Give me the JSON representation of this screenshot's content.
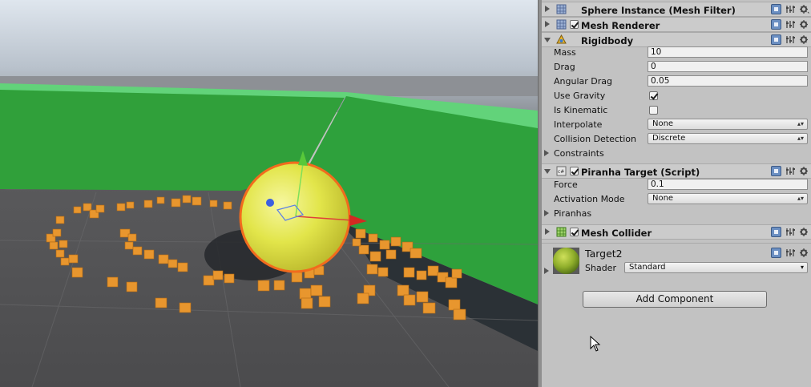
{
  "inspector": {
    "components": [
      {
        "title": "Sphere Instance (Mesh Filter)",
        "icon": "mesh-filter-icon",
        "has_checkbox": false,
        "expanded": false
      },
      {
        "title": "Mesh Renderer",
        "icon": "mesh-renderer-icon",
        "has_checkbox": true,
        "checked": true,
        "expanded": false
      },
      {
        "title": "Rigidbody",
        "icon": "rigidbody-icon",
        "has_checkbox": false,
        "expanded": true
      },
      {
        "title": "Piranha Target (Script)",
        "icon": "script-icon",
        "has_checkbox": true,
        "checked": true,
        "expanded": true
      },
      {
        "title": "Mesh Collider",
        "icon": "mesh-collider-icon",
        "has_checkbox": true,
        "checked": true,
        "expanded": false
      }
    ],
    "rigidbody": {
      "mass_label": "Mass",
      "mass": "10",
      "drag_label": "Drag",
      "drag": "0",
      "angular_drag_label": "Angular Drag",
      "angular_drag": "0.05",
      "use_gravity_label": "Use Gravity",
      "use_gravity": true,
      "is_kinematic_label": "Is Kinematic",
      "is_kinematic": false,
      "interpolate_label": "Interpolate",
      "interpolate": "None",
      "collision_detection_label": "Collision Detection",
      "collision_detection": "Discrete",
      "constraints_label": "Constraints"
    },
    "piranha": {
      "force_label": "Force",
      "force": "0.1",
      "activation_mode_label": "Activation Mode",
      "activation_mode": "None",
      "piranhas_label": "Piranhas"
    },
    "material": {
      "name": "Target2",
      "shader_label": "Shader",
      "shader": "Standard"
    },
    "add_component_label": "Add Component"
  },
  "colors": {
    "selection_outline": "#f26b1d",
    "sphere": "#e9ec4a",
    "wall": "#2e9e3a",
    "cubes": "#e8962e",
    "inspector_bg": "#c2c2c2"
  }
}
